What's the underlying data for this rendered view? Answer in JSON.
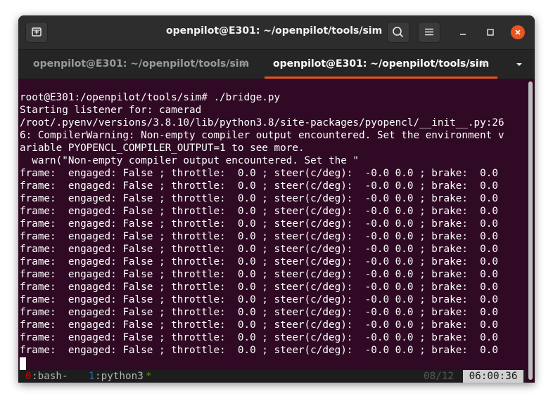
{
  "window": {
    "title": "openpilot@E301: ~/openpilot/tools/sim"
  },
  "header": {
    "new_tab_icon": "new-tab-icon",
    "search_icon": "search-icon",
    "menu_icon": "hamburger-menu-icon",
    "minimize_icon": "minimize-icon",
    "maximize_icon": "maximize-icon",
    "close_icon": "close-icon"
  },
  "tabs": [
    {
      "label": "openpilot@E301: ~/openpilot/tools/sim",
      "close": "×",
      "active": false
    },
    {
      "label": "openpilot@E301: ~/openpilot/tools/sim",
      "close": "×",
      "active": true
    }
  ],
  "tab_menu_icon": "dropdown-triangle-icon",
  "terminal": {
    "lines": [
      "root@E301:/openpilot/tools/sim# ./bridge.py",
      "Starting listener for: camerad",
      "/root/.pyenv/versions/3.8.10/lib/python3.8/site-packages/pyopencl/__init__.py:26",
      "6: CompilerWarning: Non-empty compiler output encountered. Set the environment v",
      "ariable PYOPENCL_COMPILER_OUTPUT=1 to see more.",
      "  warn(\"Non-empty compiler output encountered. Set the \"",
      "frame:  engaged: False ; throttle:  0.0 ; steer(c/deg):  -0.0 0.0 ; brake:  0.0",
      "frame:  engaged: False ; throttle:  0.0 ; steer(c/deg):  -0.0 0.0 ; brake:  0.0",
      "frame:  engaged: False ; throttle:  0.0 ; steer(c/deg):  -0.0 0.0 ; brake:  0.0",
      "frame:  engaged: False ; throttle:  0.0 ; steer(c/deg):  -0.0 0.0 ; brake:  0.0",
      "frame:  engaged: False ; throttle:  0.0 ; steer(c/deg):  -0.0 0.0 ; brake:  0.0",
      "frame:  engaged: False ; throttle:  0.0 ; steer(c/deg):  -0.0 0.0 ; brake:  0.0",
      "frame:  engaged: False ; throttle:  0.0 ; steer(c/deg):  -0.0 0.0 ; brake:  0.0",
      "frame:  engaged: False ; throttle:  0.0 ; steer(c/deg):  -0.0 0.0 ; brake:  0.0",
      "frame:  engaged: False ; throttle:  0.0 ; steer(c/deg):  -0.0 0.0 ; brake:  0.0",
      "frame:  engaged: False ; throttle:  0.0 ; steer(c/deg):  -0.0 0.0 ; brake:  0.0",
      "frame:  engaged: False ; throttle:  0.0 ; steer(c/deg):  -0.0 0.0 ; brake:  0.0",
      "frame:  engaged: False ; throttle:  0.0 ; steer(c/deg):  -0.0 0.0 ; brake:  0.0",
      "frame:  engaged: False ; throttle:  0.0 ; steer(c/deg):  -0.0 0.0 ; brake:  0.0",
      "frame:  engaged: False ; throttle:  0.0 ; steer(c/deg):  -0.0 0.0 ; brake:  0.0",
      "frame:  engaged: False ; throttle:  0.0 ; steer(c/deg):  -0.0 0.0 ; brake:  0.0"
    ]
  },
  "tmux": {
    "win0_index": "0",
    "win0_name": ":bash-",
    "win1_index": "1",
    "win1_name": ":python3",
    "win1_flag": "*",
    "pane_count": "08/12",
    "clock": "06:00:36"
  },
  "colors": {
    "accent": "#e95420",
    "terminal_bg": "#300a24",
    "tmux_index0": "#cc0000",
    "tmux_index1": "#3465a4",
    "tmux_name": "#b3b3b3",
    "tmux_flag": "#4e9a06",
    "tmux_dim": "#585858"
  }
}
